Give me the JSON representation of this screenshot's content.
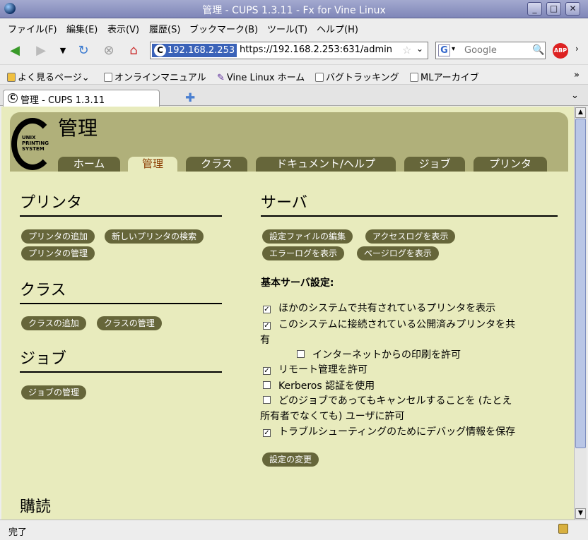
{
  "window": {
    "title": "管理 - CUPS 1.3.11 - Fx for Vine Linux"
  },
  "menubar": {
    "items": [
      "ファイル(F)",
      "編集(E)",
      "表示(V)",
      "履歴(S)",
      "ブックマーク(B)",
      "ツール(T)",
      "ヘルプ(H)"
    ]
  },
  "navbar": {
    "site_identity": "192.168.2.253",
    "url": "https://192.168.2.253:631/admin",
    "search_placeholder": "Google",
    "abp": "ABP"
  },
  "bookmarks": [
    "よく見るページ",
    "オンラインマニュアル",
    "Vine Linux ホーム",
    "バグトラッキング",
    "MLアーカイブ"
  ],
  "tab": {
    "label": "管理 - CUPS 1.3.11"
  },
  "status": "完了",
  "cups": {
    "logo_lines": [
      "UNIX",
      "PRINTING",
      "SYSTEM"
    ],
    "page_title": "管理",
    "nav": [
      "ホーム",
      "管理",
      "クラス",
      "ドキュメント/ヘルプ",
      "ジョブ",
      "プリンタ"
    ],
    "active_nav": "管理",
    "printers": {
      "heading": "プリンタ",
      "buttons": [
        "プリンタの追加",
        "新しいプリンタの検索",
        "プリンタの管理"
      ]
    },
    "classes": {
      "heading": "クラス",
      "buttons": [
        "クラスの追加",
        "クラスの管理"
      ]
    },
    "jobs": {
      "heading": "ジョブ",
      "buttons": [
        "ジョブの管理"
      ]
    },
    "subscriptions": {
      "heading": "購読"
    },
    "server": {
      "heading": "サーバ",
      "buttons": [
        "設定ファイルの編集",
        "アクセスログを表示",
        "エラーログを表示",
        "ページログを表示"
      ],
      "settings_title": "基本サーバ設定:",
      "options": [
        {
          "label": "ほかのシステムで共有されているプリンタを表示",
          "checked": true
        },
        {
          "label": "このシステムに接続されている公開済みプリンタを共",
          "label_cont": "有",
          "checked": true
        },
        {
          "label": "インターネットからの印刷を許可",
          "checked": false
        },
        {
          "label": "リモート管理を許可",
          "checked": true
        },
        {
          "label": "Kerberos 認証を使用",
          "checked": false
        },
        {
          "label": "どのジョブであってもキャンセルすることを (たとえ",
          "label_cont": "所有者でなくても) ユーザに許可",
          "checked": false
        },
        {
          "label": "トラブルシューティングのためにデバッグ情報を保存",
          "checked": true
        }
      ],
      "apply_button": "設定の変更"
    }
  }
}
